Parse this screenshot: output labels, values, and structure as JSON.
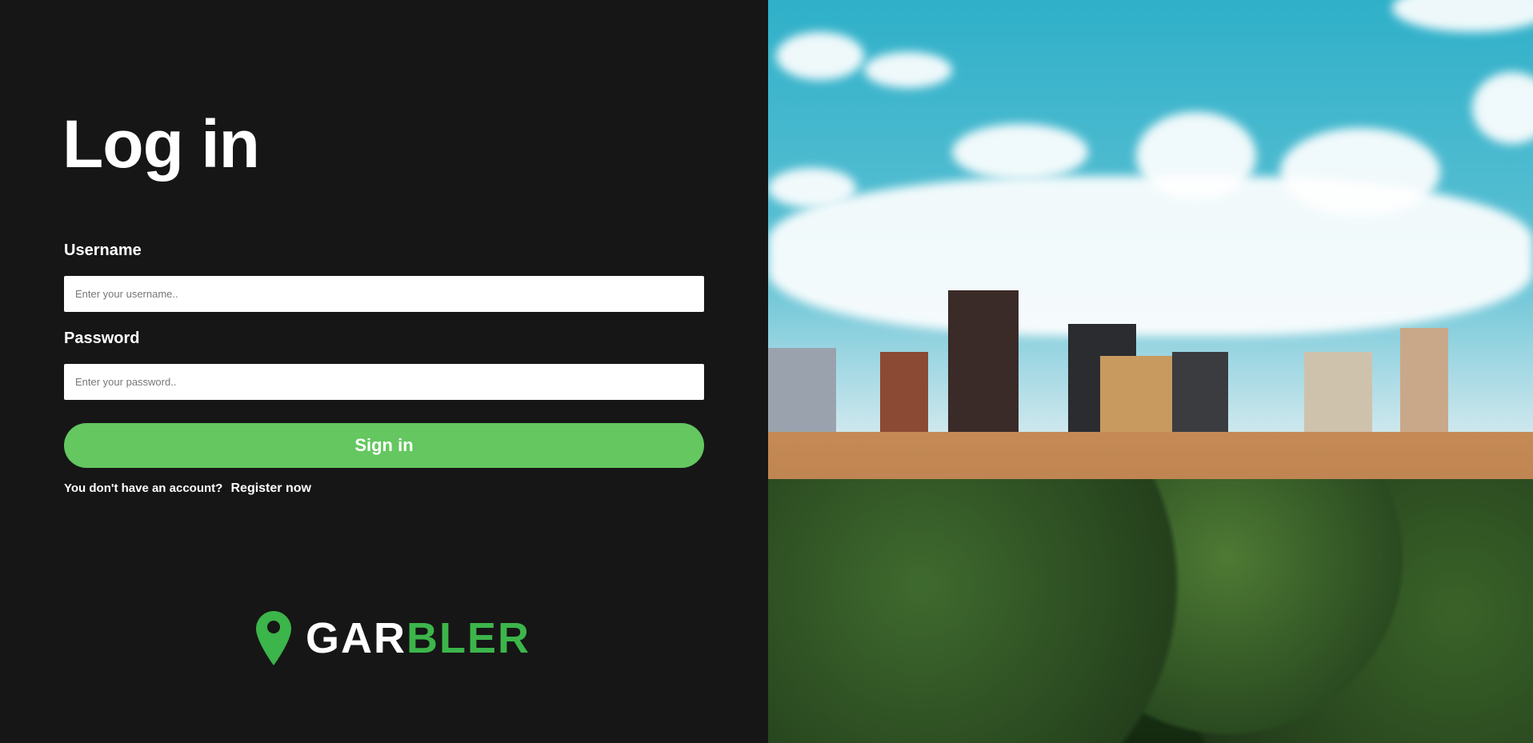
{
  "title": "Log in",
  "form": {
    "username_label": "Username",
    "username_placeholder": "Enter your username..",
    "password_label": "Password",
    "password_placeholder": "Enter your password..",
    "submit_label": "Sign in",
    "register_prompt": "You don't have an account?",
    "register_link": "Register now"
  },
  "logo": {
    "part1": "GAR",
    "part2": "BLER",
    "accent": "#3cb54a",
    "icon": "map-pin-icon"
  },
  "colors": {
    "background": "#161616",
    "button": "#64c760"
  }
}
